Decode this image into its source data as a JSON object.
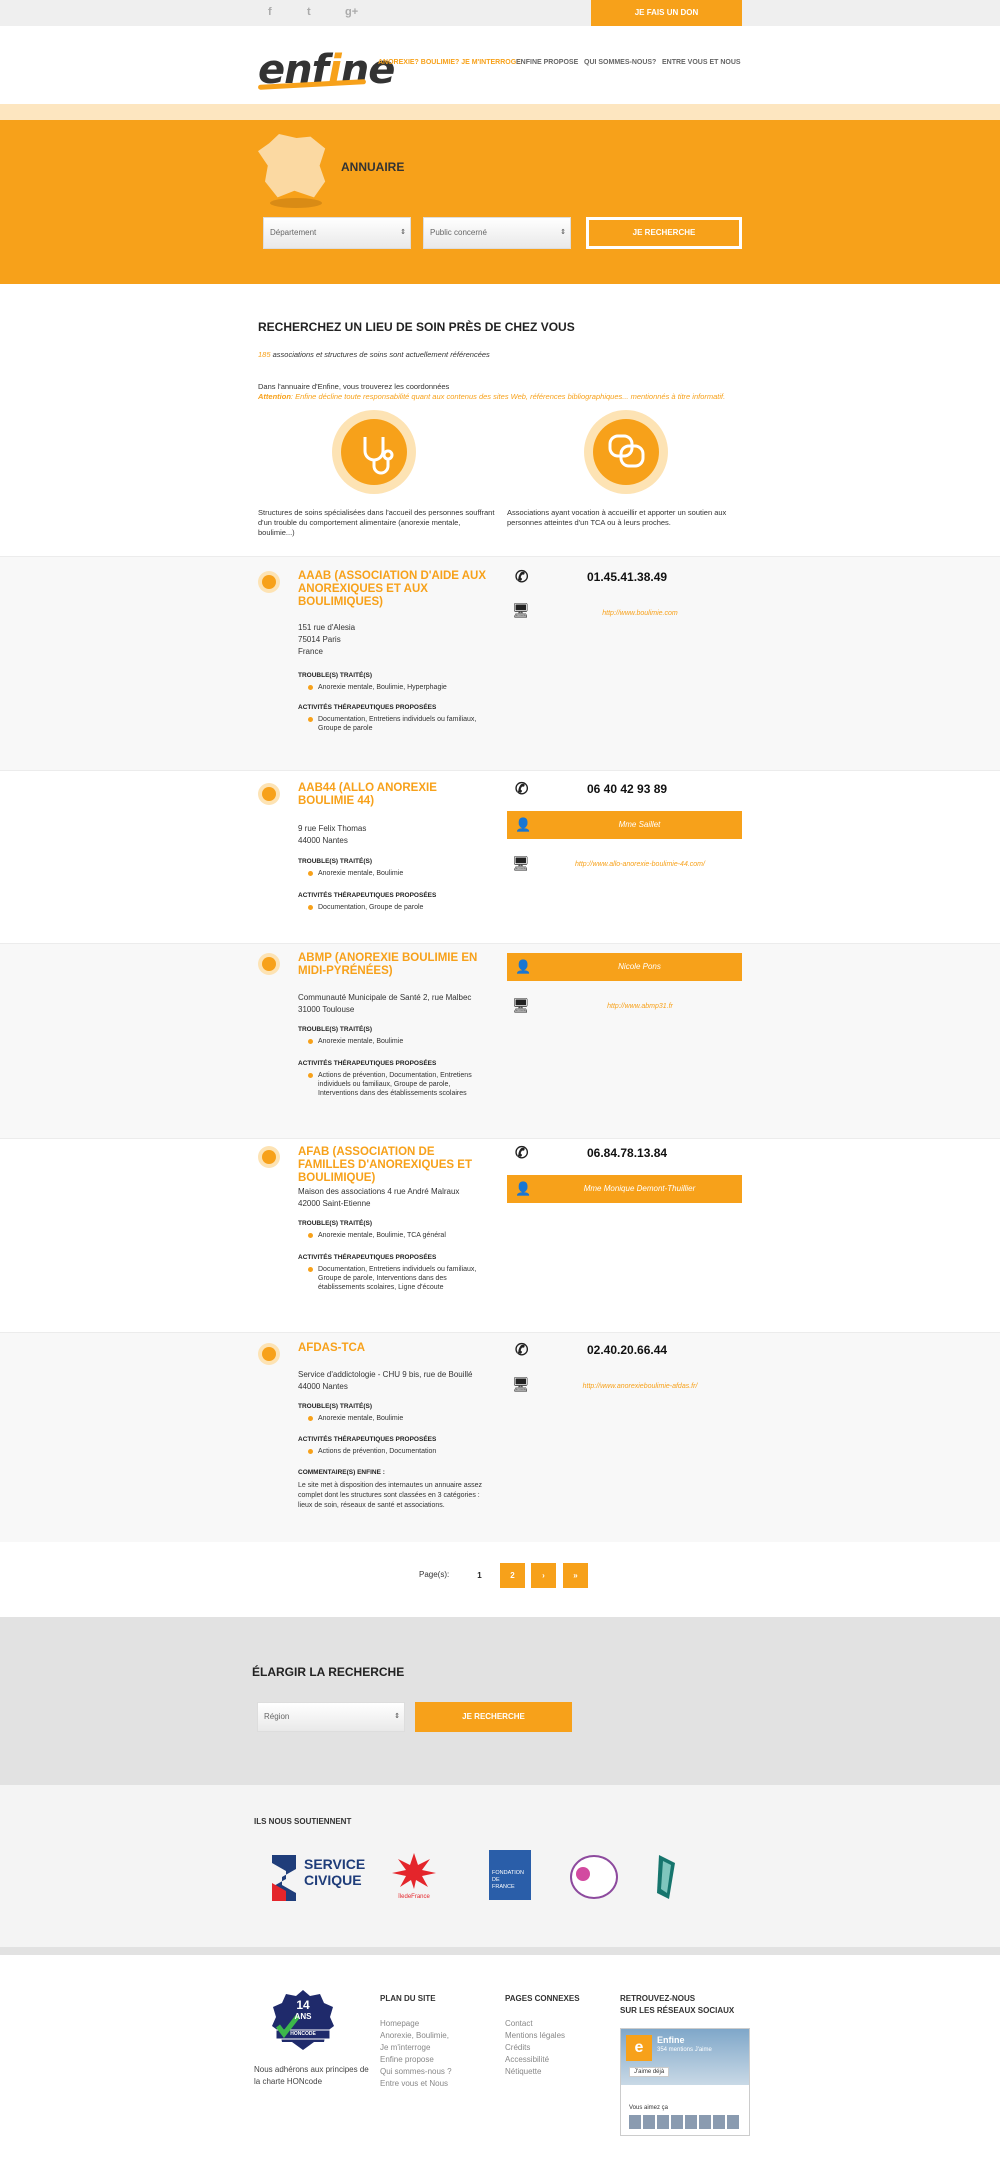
{
  "topbar": {
    "social": [
      "f",
      "t",
      "g+"
    ],
    "donate_label": "JE FAIS UN DON"
  },
  "header": {
    "logo": {
      "part1": "enf",
      "accent": "i",
      "part2": "ne"
    },
    "nav": [
      "ANOREXIE? BOULIMIE? JE M'INTERROGE",
      "ENFINE PROPOSE",
      "QUI SOMMES-NOUS?",
      "ENTRE VOUS ET NOUS"
    ]
  },
  "hero": {
    "title": "ANNUAIRE",
    "select_departement": "Département",
    "select_public": "Public concerné",
    "search_label": "JE RECHERCHE"
  },
  "intro": {
    "title": "RECHERCHEZ UN LIEU DE SOIN PRÈS DE CHEZ VOUS",
    "count": "185",
    "count_text": " associations et structures de soins sont actuellement référencées",
    "line1": "Dans l'annuaire d'Enfine, vous trouverez les coordonnées",
    "attention_label": "Attention",
    "attention_text": ": Enfine décline toute responsabilité quant aux contenus des sites Web, références bibliographiques... mentionnés à titre informatif.",
    "left_caption": "Structures de soins spécialisées dans l'accueil des personnes souffrant d'un trouble du comportement alimentaire (anorexie mentale, boulimie...)",
    "right_caption": "Associations ayant vocation à accueillir et apporter un soutien aux personnes atteintes d'un TCA ou à leurs proches."
  },
  "labels": {
    "troubles": "TROUBLE(S) TRAITÉ(S)",
    "activites": "ACTIVITÉS THÉRAPEUTIQUES PROPOSÉES",
    "commentaire": "COMMENTAIRE(S) ENFINE :"
  },
  "results": [
    {
      "title": "AAAB (ASSOCIATION D'AIDE AUX ANOREXIQUES ET AUX BOULIMIQUES)",
      "address": [
        "151 rue d'Alesia",
        "75014 Paris",
        "France"
      ],
      "troubles": "Anorexie mentale, Boulimie, Hyperphagie",
      "activites": "Documentation, Entretiens individuels ou familiaux, Groupe de parole",
      "phone": "01.45.41.38.49",
      "web": "http://www.boulimie.com"
    },
    {
      "title": "AAB44 (ALLO ANOREXIE BOULIMIE 44)",
      "address": [
        "9 rue Felix Thomas",
        "44000 Nantes"
      ],
      "troubles": "Anorexie mentale, Boulimie",
      "activites": "Documentation, Groupe de parole",
      "phone": "06 40 42 93 89",
      "contact": "Mme Saillet",
      "web": "http://www.allo-anorexie-boulimie-44.com/"
    },
    {
      "title": "ABMP (ANOREXIE BOULIMIE EN MIDI-PYRÉNÉES)",
      "address": [
        "Communauté Municipale de Santé 2, rue Malbec",
        "31000 Toulouse"
      ],
      "troubles": "Anorexie mentale, Boulimie",
      "activites": "Actions de prévention, Documentation, Entretiens individuels ou familiaux, Groupe de parole, Interventions dans des établissements scolaires",
      "contact": "Nicole Pons",
      "web": "http://www.abmp31.fr"
    },
    {
      "title": "AFAB (ASSOCIATION DE FAMILLES D'ANOREXIQUES ET BOULIMIQUE)",
      "address": [
        "Maison des associations 4 rue André Malraux",
        "42000 Saint-Etienne"
      ],
      "troubles": "Anorexie mentale, Boulimie, TCA général",
      "activites": "Documentation, Entretiens individuels ou familiaux, Groupe de parole, Interventions dans des établissements scolaires, Ligne d'écoute",
      "phone": "06.84.78.13.84",
      "contact": "Mme Monique Demont-Thuillier"
    },
    {
      "title": "AFDAS-TCA",
      "address": [
        "Service d'addictologie - CHU 9 bis, rue de Bouillé",
        "44000 Nantes"
      ],
      "troubles": "Anorexie mentale, Boulimie",
      "activites": "Actions de prévention, Documentation",
      "commentaire": "Le site met à disposition des internautes un annuaire assez complet dont les structures sont classées en 3 catégories : lieux de soin, réseaux de santé et associations.",
      "phone": "02.40.20.66.44",
      "web": "http://www.anorexieboulimie-afdas.fr/"
    }
  ],
  "pagination": {
    "label": "Page(s):",
    "pages": [
      "1",
      "2",
      "›",
      "»"
    ]
  },
  "widen": {
    "title": "ÉLARGIR LA RECHERCHE",
    "select_region": "Région",
    "search_label": "JE RECHERCHE"
  },
  "sponsors": {
    "title": "ILS NOUS SOUTIENNENT",
    "service_civique": [
      "SERVICE",
      "CIVIQUE"
    ],
    "idf": "îledeFrance",
    "fondation": [
      "FONDATION",
      "DE",
      "FRANCE"
    ]
  },
  "footer": {
    "hon_badge": [
      "14",
      "ANS",
      "HONCODE"
    ],
    "hon_text": "Nous adhérons aux principes de la charte HONcode",
    "plan_title": "PLAN DU SITE",
    "plan_links": [
      "Homepage",
      "Anorexie, Boulimie,",
      "Je m'interroge",
      "Enfine propose",
      "Qui sommes-nous ?",
      "Entre vous et Nous"
    ],
    "pages_title": "PAGES CONNEXES",
    "pages_links": [
      "Contact",
      "Mentions légales",
      "Crédits",
      "Accessibilité",
      "Nétiquette"
    ],
    "social_title": [
      "RETROUVEZ-NOUS",
      "SUR LES RÉSEAUX SOCIAUX"
    ],
    "fb_name": "Enfine",
    "fb_count": "354 mentions J'aime",
    "fb_like": "J'aime déjà",
    "fb_friends": "Vous aimez ça"
  }
}
